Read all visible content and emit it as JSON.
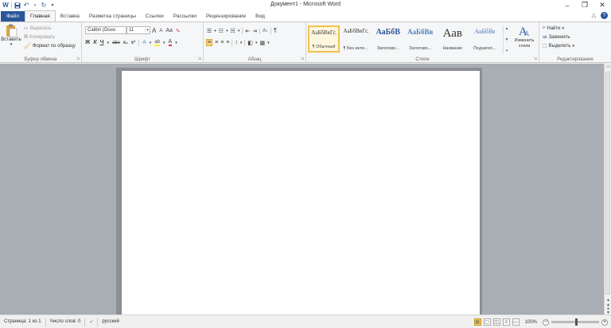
{
  "window": {
    "title": "Документ1 - Microsoft Word",
    "minimize_icon": "–",
    "maximize_icon": "❐",
    "close_icon": "✕"
  },
  "qat": {
    "word_icon": "W",
    "save_icon": "💾",
    "undo_icon": "↶",
    "redo_icon": "↻",
    "customize_icon": "▾"
  },
  "tabs": {
    "file": "Файл",
    "items": [
      "Главная",
      "Вставка",
      "Разметка страницы",
      "Ссылки",
      "Рассылки",
      "Рецензирование",
      "Вид"
    ],
    "help_icon": "?",
    "collapse_icon": "△"
  },
  "clipboard": {
    "paste": "Вставить",
    "cut": "Вырезать",
    "copy": "Копировать",
    "format_painter": "Формат по образцу",
    "label": "Буфер обмена"
  },
  "font": {
    "name": "Calibri (Осно",
    "size": "11",
    "grow_icon": "A",
    "shrink_icon": "A",
    "case_label": "Aa",
    "clear_icon": "✎",
    "bold": "Ж",
    "italic": "К",
    "underline": "Ч",
    "strike": "abc",
    "subscript": "x₂",
    "superscript": "x²",
    "effects_icon": "A",
    "highlight_icon": "ab",
    "color_icon": "A",
    "label": "Шрифт"
  },
  "paragraph": {
    "label": "Абзац",
    "bullets_icon": "☰",
    "numbering_icon": "☷",
    "multilevel_icon": "☵",
    "decrease_indent_icon": "⇤",
    "increase_indent_icon": "⇥",
    "sort_icon": "A↓",
    "pilcrow_icon": "¶",
    "align_left_icon": "≡",
    "align_center_icon": "≡",
    "align_right_icon": "≡",
    "justify_icon": "≡",
    "line_spacing_icon": "↕",
    "shading_icon": "◧",
    "borders_icon": "▦"
  },
  "styles": {
    "label": "Стили",
    "items": [
      {
        "sample": "АаБбВвГг,",
        "name": "¶ Обычный",
        "size": "7"
      },
      {
        "sample": "АаБбВвГг,",
        "name": "¶ Без инте...",
        "size": "7"
      },
      {
        "sample": "АаБбВ",
        "name": "Заголово...",
        "size": "10"
      },
      {
        "sample": "АаБбВв",
        "name": "Заголово...",
        "size": "9"
      },
      {
        "sample": "Аав",
        "name": "Название",
        "size": "15"
      },
      {
        "sample": "АаБбВв",
        "name": "Подзагол...",
        "size": "8"
      }
    ],
    "change_styles": "Изменить стили",
    "scroll_up": "▲",
    "scroll_down": "▼",
    "more": "▾"
  },
  "editing": {
    "label": "Редактирование",
    "find": "Найти",
    "replace": "Заменить",
    "select": "Выделить",
    "find_icon": "🔍",
    "replace_icon": "ab",
    "select_icon": "⬚"
  },
  "status": {
    "page": "Страница: 1 из 1",
    "words": "Число слов: 0",
    "lang": "русский",
    "zoom": "100%",
    "zoom_minus": "−",
    "zoom_plus": "+",
    "proof_icon": "✓"
  },
  "scroll": {
    "up": "▲",
    "down": "▼",
    "prev": "▲",
    "next": "▼",
    "browse": "●"
  }
}
